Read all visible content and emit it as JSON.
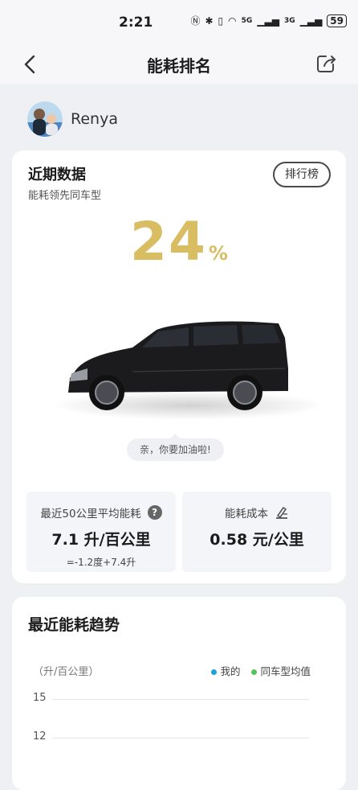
{
  "status": {
    "time": "2:21",
    "signal_5g": "5G",
    "signal_3g": "3G",
    "battery": "59"
  },
  "nav": {
    "title": "能耗排名"
  },
  "user": {
    "name": "Renya"
  },
  "recent": {
    "title": "近期数据",
    "subtitle": "能耗领先同车型",
    "rank_button": "排行榜",
    "percent": "24",
    "percent_unit": "%",
    "encourage": "亲，你要加油啦!",
    "avg_label": "最近50公里平均能耗",
    "avg_value": "7.1 升/百公里",
    "avg_note": "=-1.2度+7.4升",
    "cost_label": "能耗成本",
    "cost_value": "0.58 元/公里"
  },
  "trend": {
    "title": "最近能耗趋势",
    "unit": "（升/百公里）",
    "legend": [
      {
        "name": "我的",
        "color": "#1aa4d8"
      },
      {
        "name": "同车型均值",
        "color": "#5bc15d"
      }
    ],
    "yticks": [
      "15",
      "12"
    ]
  }
}
